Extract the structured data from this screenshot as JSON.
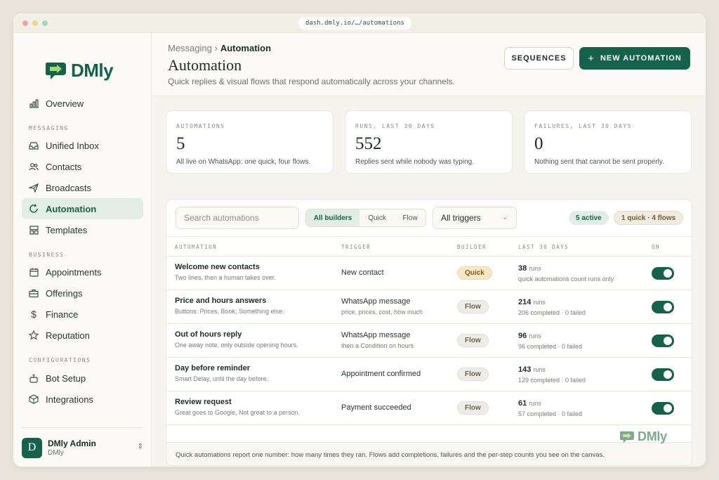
{
  "browser": {
    "url": "dash.dmly.io/…/automations",
    "dot_colors": [
      "#e9a8a0",
      "#ead59b",
      "#a9d3b4"
    ]
  },
  "brand": {
    "name": "DMly",
    "color": "#16614a"
  },
  "sidebar": {
    "top_items": [
      {
        "label": "Overview",
        "icon": "bar-chart-icon"
      }
    ],
    "sections": [
      {
        "label": "MESSAGING",
        "items": [
          {
            "label": "Unified Inbox",
            "icon": "inbox-icon"
          },
          {
            "label": "Contacts",
            "icon": "users-icon"
          },
          {
            "label": "Broadcasts",
            "icon": "send-icon"
          },
          {
            "label": "Automation",
            "icon": "refresh-icon",
            "active": true
          },
          {
            "label": "Templates",
            "icon": "layout-icon"
          }
        ]
      },
      {
        "label": "BUSINESS",
        "items": [
          {
            "label": "Appointments",
            "icon": "calendar-icon"
          },
          {
            "label": "Offerings",
            "icon": "briefcase-icon"
          },
          {
            "label": "Finance",
            "icon": "dollar-icon"
          },
          {
            "label": "Reputation",
            "icon": "star-icon"
          }
        ]
      },
      {
        "label": "CONFIGURATIONS",
        "items": [
          {
            "label": "Bot Setup",
            "icon": "bot-icon"
          },
          {
            "label": "Integrations",
            "icon": "cube-icon"
          }
        ]
      }
    ],
    "user": {
      "initial": "D",
      "name": "DMly Admin",
      "org": "DMly"
    }
  },
  "header": {
    "breadcrumb_parent": "Messaging ›",
    "breadcrumb_current": "Automation",
    "title": "Automation",
    "subtitle": "Quick replies & visual flows that respond automatically across your channels.",
    "sequences_label": "SEQUENCES",
    "new_label": "NEW AUTOMATION"
  },
  "stats": [
    {
      "label": "AUTOMATIONS",
      "value": "5",
      "note": "All live on WhatsApp: one quick, four flows."
    },
    {
      "label": "RUNS, LAST 30 DAYS",
      "value": "552",
      "note": "Replies sent while nobody was typing."
    },
    {
      "label": "FAILURES, LAST 30 DAYS",
      "value": "0",
      "note": "Nothing sent that cannot be sent properly."
    }
  ],
  "filters": {
    "search_placeholder": "Search automations",
    "builders": [
      "All builders",
      "Quick",
      "Flow"
    ],
    "trigger_select": "All triggers",
    "active_pill": "5 active",
    "mix_pill": "1 quick · 4 flows"
  },
  "table": {
    "headers": [
      "AUTOMATION",
      "TRIGGER",
      "BUILDER",
      "LAST 30 DAYS",
      "ON"
    ],
    "rows": [
      {
        "name": "Welcome new contacts",
        "desc": "Two lines, then a human takes over.",
        "trigger": "New contact",
        "trigger_detail": "",
        "builder": "Quick",
        "runs": "38",
        "runs_unit": "runs",
        "detail": "quick automations count runs only",
        "on": true
      },
      {
        "name": "Price and hours answers",
        "desc": "Buttons: Prices, Book, Something else.",
        "trigger": "WhatsApp message",
        "trigger_detail": "price, prices, cost, how much",
        "builder": "Flow",
        "runs": "214",
        "runs_unit": "runs",
        "detail": "206 completed · 0 failed",
        "on": true
      },
      {
        "name": "Out of hours reply",
        "desc": "One away note, only outside opening hours.",
        "trigger": "WhatsApp message",
        "trigger_detail": "then a Condition on hours",
        "builder": "Flow",
        "runs": "96",
        "runs_unit": "runs",
        "detail": "96 completed · 0 failed",
        "on": true
      },
      {
        "name": "Day before reminder",
        "desc": "Smart Delay, until the day before.",
        "trigger": "Appointment confirmed",
        "trigger_detail": "",
        "builder": "Flow",
        "runs": "143",
        "runs_unit": "runs",
        "detail": "129 completed · 0 failed",
        "on": true
      },
      {
        "name": "Review request",
        "desc": "Great goes to Google, Not great to a person.",
        "trigger": "Payment succeeded",
        "trigger_detail": "",
        "builder": "Flow",
        "runs": "61",
        "runs_unit": "runs",
        "detail": "57 completed · 0 failed",
        "on": true
      }
    ],
    "footer": "Quick automations report one number: how many times they ran. Flows add completions, failures and the per-step counts you see on the canvas."
  }
}
